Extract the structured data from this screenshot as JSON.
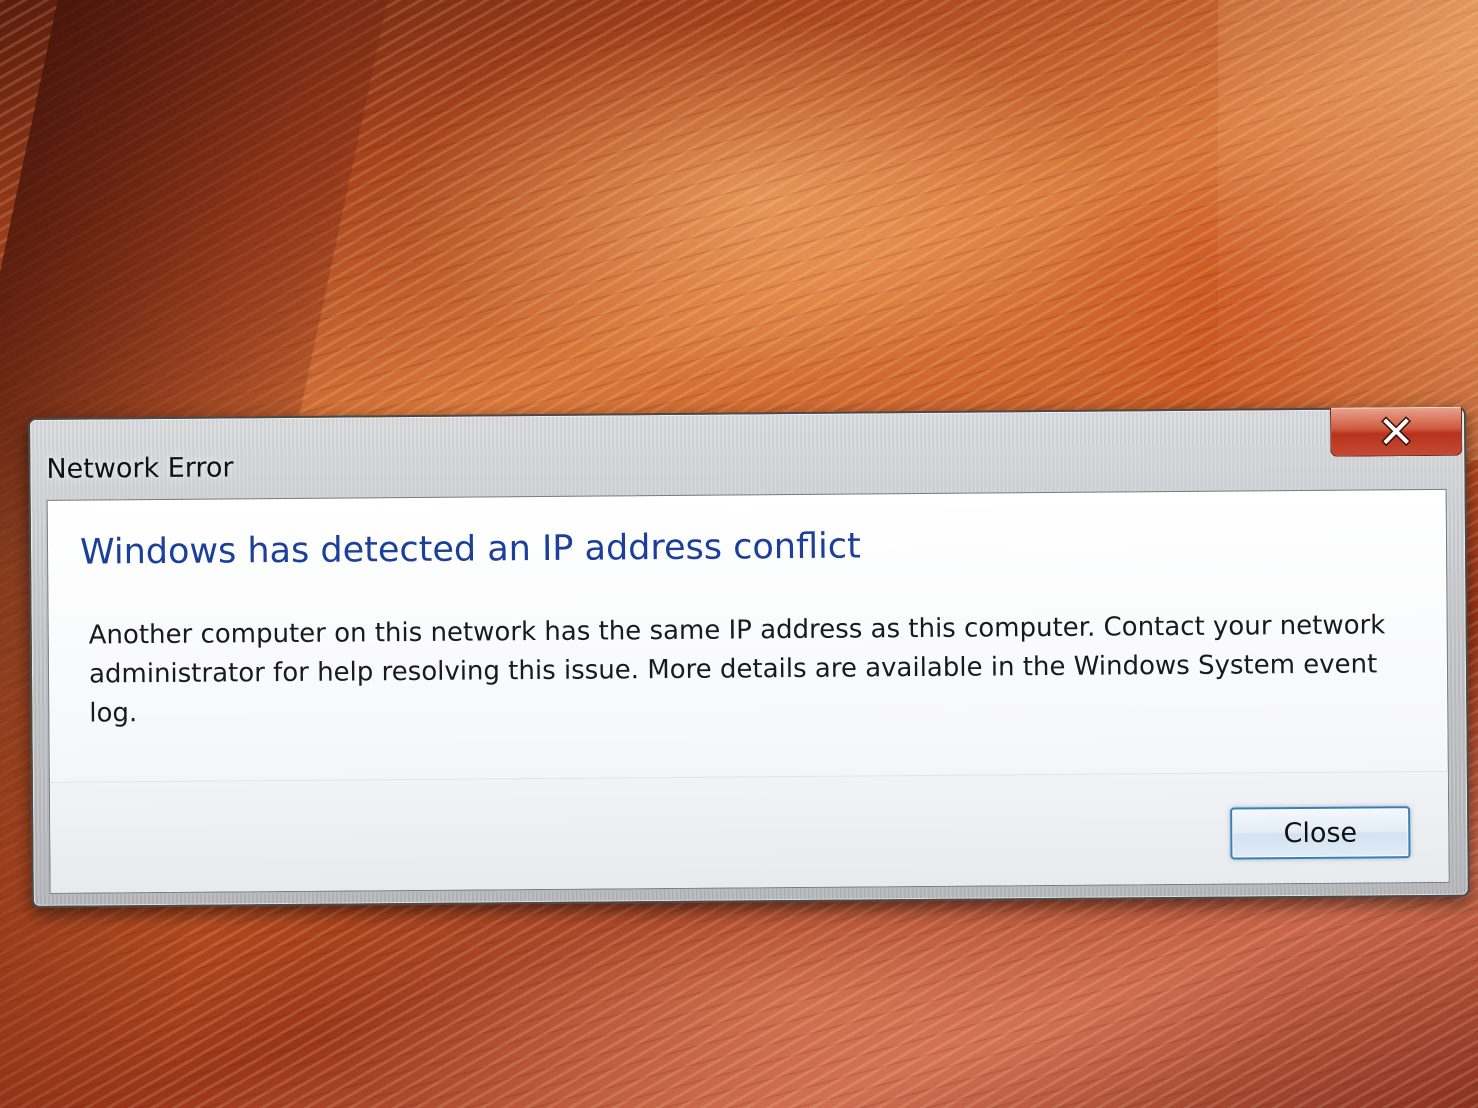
{
  "dialog": {
    "title": "Network Error",
    "close_icon": "close-x-icon",
    "main_instruction": "Windows has detected an IP address conflict",
    "message": "Another computer on this network has the same IP address as this computer. Contact your network administrator for help resolving this issue. More details are available in the Windows System event log.",
    "close_button_label": "Close"
  },
  "colors": {
    "main_instruction": "#1b3f9a",
    "close_x_button": "#c44a33",
    "button_focus_border": "#3c7fb1"
  }
}
